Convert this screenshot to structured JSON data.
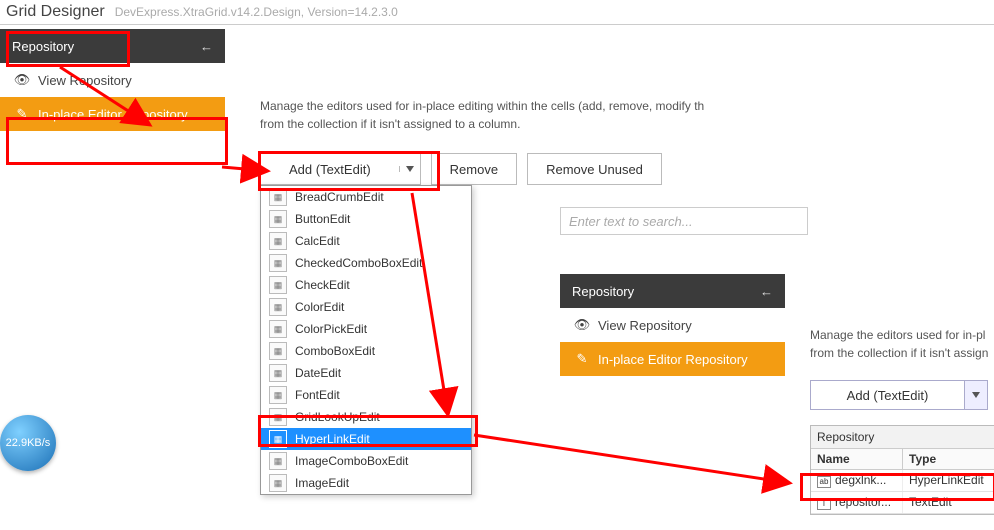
{
  "app_title": "Grid Designer",
  "version": "DevExpress.XtraGrid.v14.2.Design, Version=14.2.3.0",
  "sidebar": {
    "header": "Repository",
    "items": [
      {
        "label": "View Repository"
      },
      {
        "label": "In-place Editor Repository"
      }
    ]
  },
  "help_line1": "Manage the editors used for in-place editing within the cells (add, remove, modify th",
  "help_line2": "from the collection if it isn't assigned to a column.",
  "buttons": {
    "add": "Add (TextEdit)",
    "remove": "Remove",
    "remove_unused": "Remove Unused"
  },
  "search_placeholder": "Enter text to search...",
  "dropdown": [
    "BreadCrumbEdit",
    "ButtonEdit",
    "CalcEdit",
    "CheckedComboBoxEdit",
    "CheckEdit",
    "ColorEdit",
    "ColorPickEdit",
    "ComboBoxEdit",
    "DateEdit",
    "FontEdit",
    "GridLookUpEdit",
    "HyperLinkEdit",
    "ImageComboBoxEdit",
    "ImageEdit"
  ],
  "dropdown_selected": "HyperLinkEdit",
  "mini_sidebar": {
    "header": "Repository",
    "items": [
      {
        "label": "View Repository"
      },
      {
        "label": "In-place Editor Repository"
      }
    ]
  },
  "help2_line1": "Manage the editors used for in-pl",
  "help2_line2": "from the collection if it isn't assign",
  "mini_add": "Add (TextEdit)",
  "grid": {
    "group": "Repository",
    "cols": [
      "Name",
      "Type"
    ],
    "rows": [
      {
        "name": "degxlnk...",
        "type": "HyperLinkEdit"
      },
      {
        "name": "repositor...",
        "type": "TextEdit"
      }
    ]
  },
  "bubble": "22.9KB/s"
}
